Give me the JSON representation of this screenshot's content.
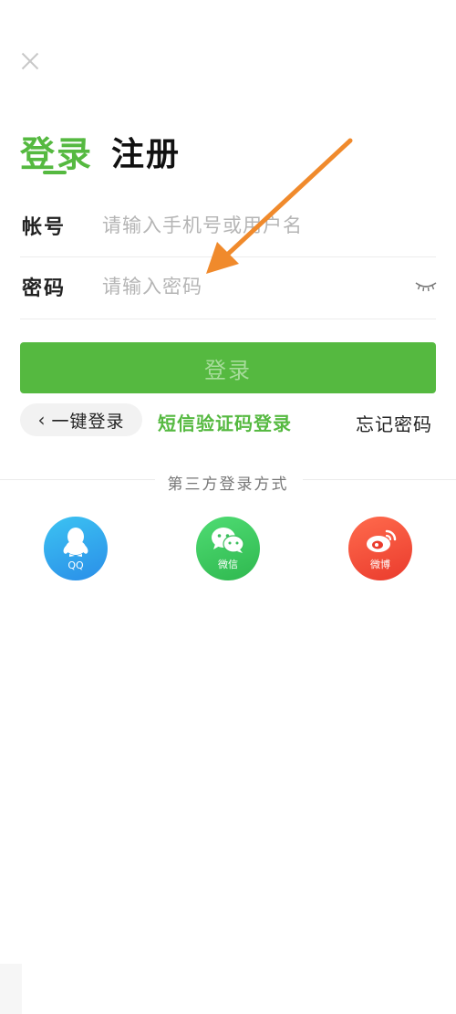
{
  "header": {
    "close_icon": "close-icon"
  },
  "tabs": [
    {
      "label": "登录",
      "active": true
    },
    {
      "label": "注册",
      "active": false
    }
  ],
  "form": {
    "account_label": "帐号",
    "account_placeholder": "请输入手机号或用户名",
    "account_value": "",
    "password_label": "密码",
    "password_placeholder": "请输入密码",
    "password_value": "",
    "password_toggle_icon": "eye-closed-icon"
  },
  "login_button": "登录",
  "links": {
    "one_key": "一键登录",
    "sms": "短信验证码登录",
    "forgot": "忘记密码"
  },
  "third_party": {
    "title": "第三方登录方式",
    "providers": [
      {
        "name": "QQ",
        "icon": "qq-icon",
        "color": "#2a9cef"
      },
      {
        "name": "微信",
        "icon": "wechat-icon",
        "color": "#36c05a"
      },
      {
        "name": "微博",
        "icon": "weibo-icon",
        "color": "#ef4a33"
      }
    ]
  },
  "colors": {
    "accent": "#55b940",
    "annotation_arrow": "#f08a2c"
  }
}
